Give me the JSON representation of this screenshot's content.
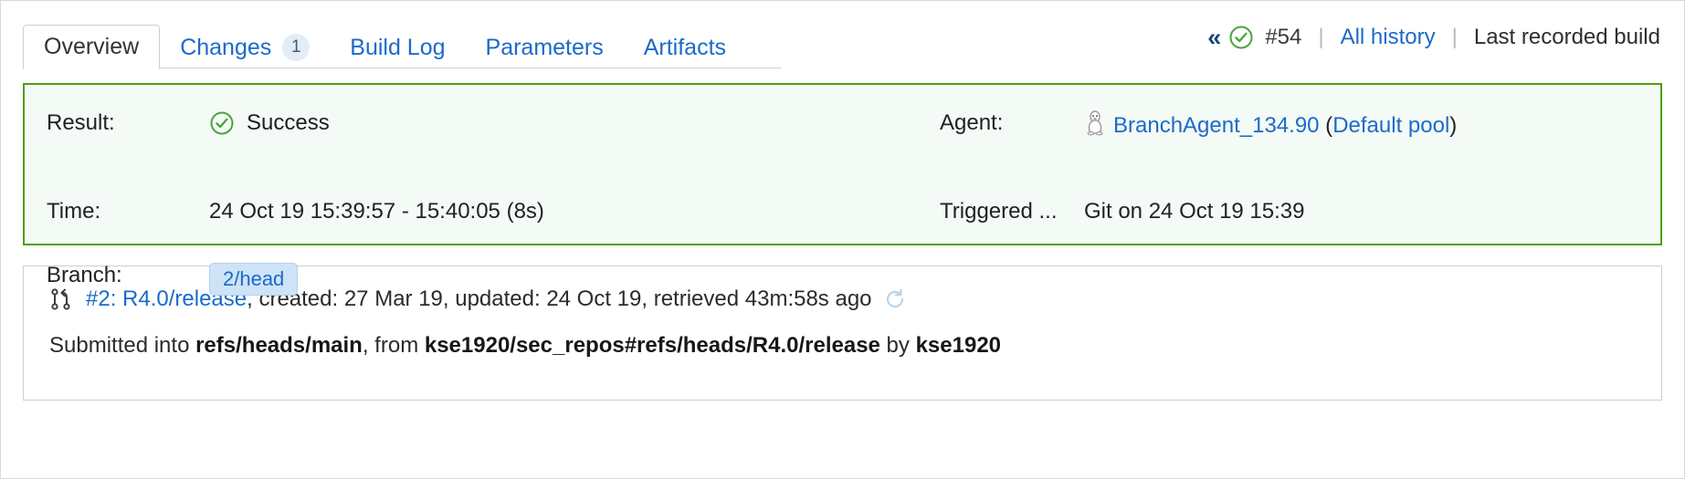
{
  "tabs": [
    {
      "label": "Overview",
      "active": true,
      "badge": null
    },
    {
      "label": "Changes",
      "active": false,
      "badge": "1"
    },
    {
      "label": "Build Log",
      "active": false,
      "badge": null
    },
    {
      "label": "Parameters",
      "active": false,
      "badge": null
    },
    {
      "label": "Artifacts",
      "active": false,
      "badge": null
    }
  ],
  "header_right": {
    "prev_chevron": "«",
    "status_icon": "success-check-icon",
    "build_number": "#54",
    "separator": "|",
    "all_history": "All history",
    "last_build": "Last recorded build"
  },
  "result_panel": {
    "result_label": "Result:",
    "result_icon": "success-check-icon",
    "result_value": "Success",
    "time_label": "Time:",
    "time_value": "24 Oct 19 15:39:57 - 15:40:05 (8s)",
    "branch_label": "Branch:",
    "branch_value": "2/head",
    "agent_label": "Agent:",
    "agent_icon": "linux-penguin-icon",
    "agent_name": "BranchAgent_134.90",
    "agent_pool_open": " (",
    "agent_pool": "Default pool",
    "agent_pool_close": ")",
    "triggered_label": "Triggered ...",
    "triggered_value": "Git on 24 Oct 19 15:39"
  },
  "change_panel": {
    "pr_icon": "pull-request-icon",
    "pr_link": "#2: R4.0/release",
    "pr_meta": ", created: 27 Mar 19, updated: 24 Oct 19, retrieved 43m:58s ago",
    "refresh_icon": "refresh-icon",
    "submitted_prefix": "Submitted into ",
    "target_branch": "refs/heads/main",
    "from_text": ", from ",
    "source_ref": "kse1920/sec_repos#refs/heads/R4.0/release",
    "by_text": " by ",
    "author": "kse1920"
  },
  "colors": {
    "success_green": "#4d9f0d",
    "panel_bg": "#f4faf5",
    "link_blue": "#1b6ac9",
    "badge_blue": "#cfe3f7"
  }
}
